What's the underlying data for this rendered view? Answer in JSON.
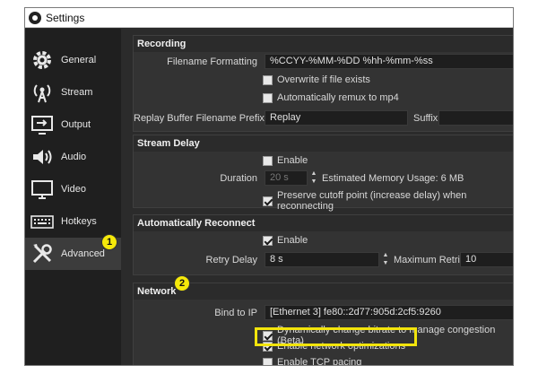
{
  "window": {
    "title": "Settings"
  },
  "sidebar": {
    "items": [
      {
        "label": "General",
        "icon": "gear-icon"
      },
      {
        "label": "Stream",
        "icon": "antenna-icon"
      },
      {
        "label": "Output",
        "icon": "output-icon"
      },
      {
        "label": "Audio",
        "icon": "speaker-icon"
      },
      {
        "label": "Video",
        "icon": "monitor-icon"
      },
      {
        "label": "Hotkeys",
        "icon": "keyboard-icon"
      },
      {
        "label": "Advanced",
        "icon": "tools-icon"
      }
    ],
    "active": "Advanced"
  },
  "recording": {
    "header": "Recording",
    "filename_label": "Filename Formatting",
    "filename_value": "%CCYY-%MM-%DD %hh-%mm-%ss",
    "overwrite_label": "Overwrite if file exists",
    "remux_label": "Automatically remux to mp4",
    "replay_prefix_label": "Replay Buffer Filename Prefix",
    "replay_prefix_value": "Replay",
    "suffix_label": "Suffix"
  },
  "stream_delay": {
    "header": "Stream Delay",
    "enable_label": "Enable",
    "duration_label": "Duration",
    "duration_value": "20 s",
    "memory_usage": "Estimated Memory Usage: 6 MB",
    "preserve_label": "Preserve cutoff point (increase delay) when reconnecting"
  },
  "auto_reconnect": {
    "header": "Automatically Reconnect",
    "enable_label": "Enable",
    "retry_delay_label": "Retry Delay",
    "retry_delay_value": "8 s",
    "max_retries_label": "Maximum Retries",
    "max_retries_value": "10"
  },
  "network": {
    "header": "Network",
    "bind_label": "Bind to IP",
    "bind_value": "[Ethernet 3] fe80::2d77:905d:2cf5:9260",
    "dynamic_bitrate_label": "Dynamically change bitrate to manage congestion (Beta)",
    "optimizations_label": "Enable network optimizations",
    "tcp_pacing_label": "Enable TCP pacing"
  },
  "callouts": {
    "one": "1",
    "two": "2"
  },
  "colors": {
    "callout": "#f5e90a",
    "highlight": "#f2e40c",
    "panel": "#333333",
    "sidebar": "#1f1f1f"
  }
}
